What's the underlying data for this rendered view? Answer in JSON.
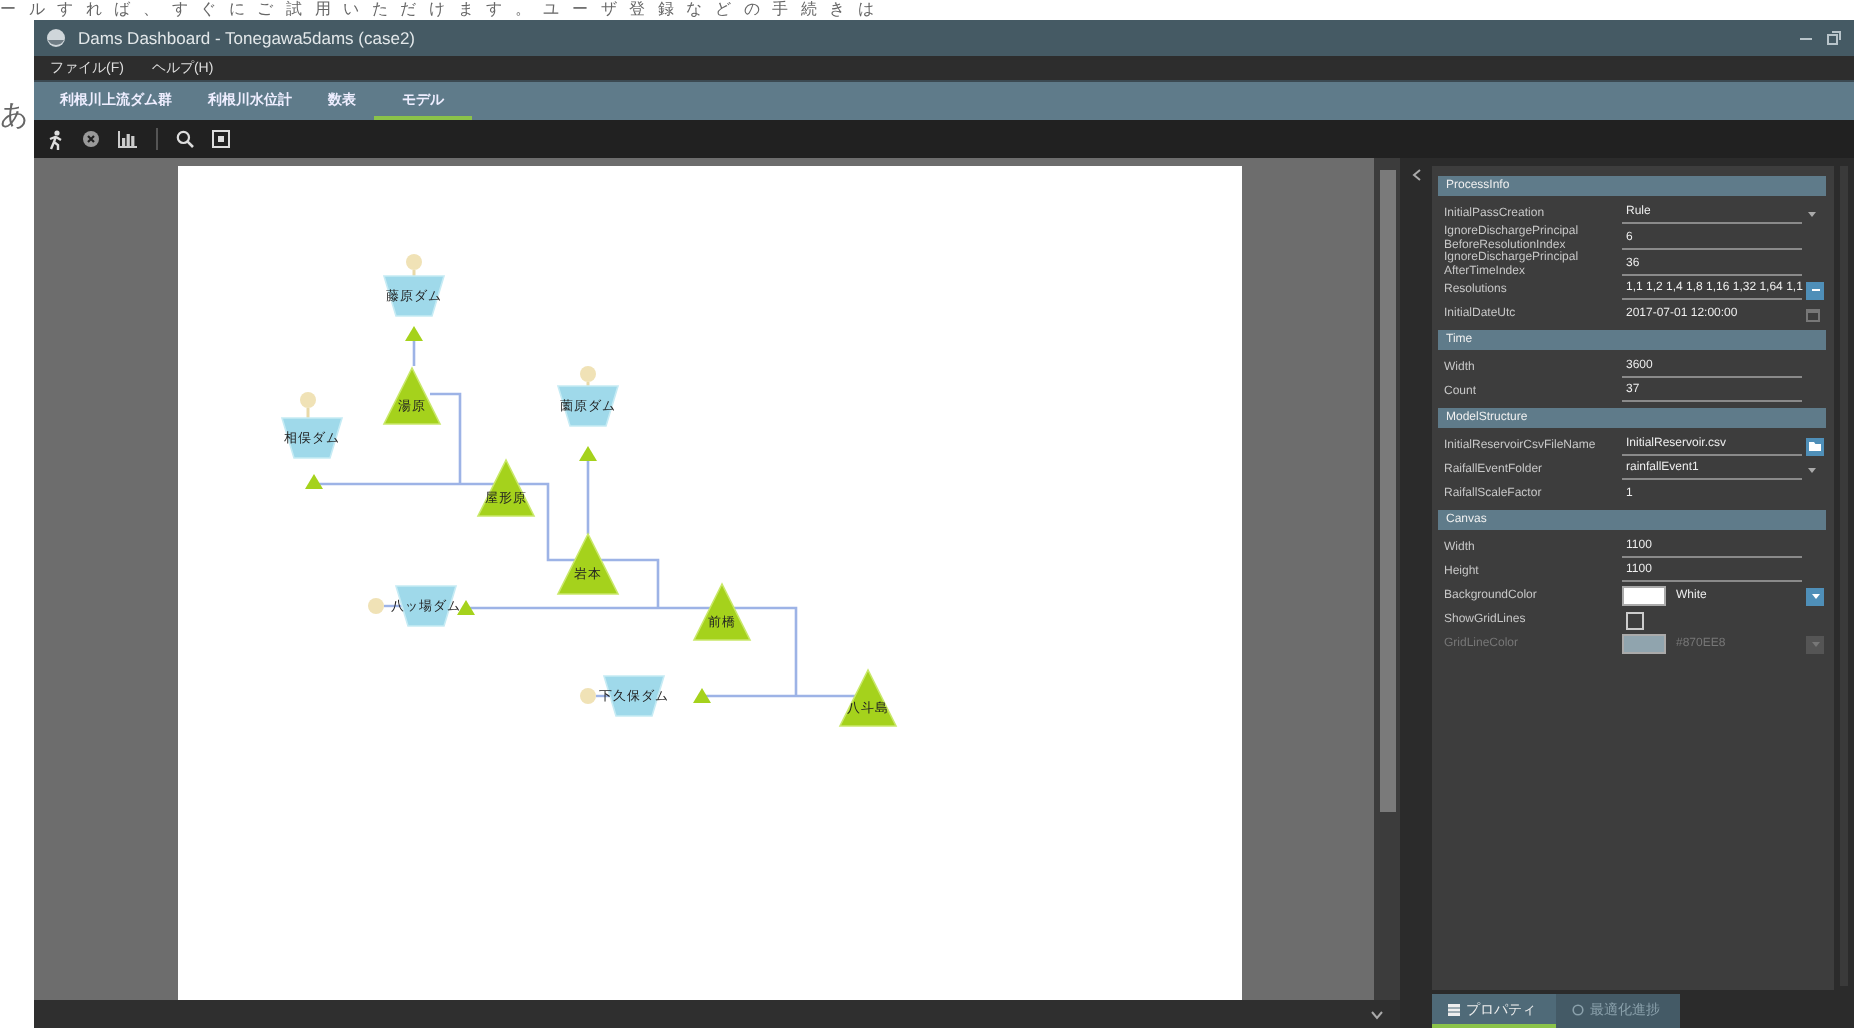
{
  "background_page": {
    "text_line": "ールすれば、すぐにご試用いただけます。ユーザ登録などの手続きは",
    "side_text": "あ"
  },
  "window": {
    "title": "Dams Dashboard - Tonegawa5dams (case2)"
  },
  "menu": [
    "ファイル(F)",
    "ヘルプ(H)"
  ],
  "tabs": [
    {
      "label": "利根川上流ダム群",
      "selected": false
    },
    {
      "label": "利根川水位計",
      "selected": false
    },
    {
      "label": "数表",
      "selected": false
    },
    {
      "label": "モデル",
      "selected": true
    }
  ],
  "model": {
    "nodes": [
      {
        "kind": "dam",
        "label": "藤原ダム"
      },
      {
        "kind": "point",
        "label": "湯原"
      },
      {
        "kind": "dam",
        "label": "相俣ダム"
      },
      {
        "kind": "dam",
        "label": "薗原ダム"
      },
      {
        "kind": "point",
        "label": "屋形原"
      },
      {
        "kind": "point",
        "label": "岩本"
      },
      {
        "kind": "dam",
        "label": "八ッ場ダム"
      },
      {
        "kind": "point",
        "label": "前橋"
      },
      {
        "kind": "dam",
        "label": "下久保ダム"
      },
      {
        "kind": "point",
        "label": "八斗島"
      }
    ]
  },
  "properties": {
    "sections": [
      {
        "title": "ProcessInfo",
        "rows": [
          {
            "kind": "dropdown",
            "name": "InitialPassCreation",
            "value": "Rule",
            "disabled": false
          },
          {
            "kind": "text",
            "name": "IgnoreDischargePrincipal BeforeResolutionIndex",
            "value": "6",
            "disabled": false
          },
          {
            "kind": "text",
            "name": "IgnoreDischargePrincipal AfterTimeIndex",
            "value": "36",
            "disabled": false
          },
          {
            "kind": "ellipsis",
            "name": "Resolutions",
            "value": "1,1 1,2 1,4 1,8 1,16 1,32 1,64 1,1",
            "disabled": false
          },
          {
            "kind": "date",
            "name": "InitialDateUtc",
            "value": "2017-07-01 12:00:00",
            "disabled": false
          }
        ]
      },
      {
        "title": "Time",
        "rows": [
          {
            "kind": "text",
            "name": "Width",
            "value": "3600",
            "disabled": false
          },
          {
            "kind": "text",
            "name": "Count",
            "value": "37",
            "disabled": false
          }
        ]
      },
      {
        "title": "ModelStructure",
        "rows": [
          {
            "kind": "file",
            "name": "InitialReservoirCsvFileName",
            "value": "InitialReservoir.csv",
            "disabled": false
          },
          {
            "kind": "dropdown",
            "name": "RaifallEventFolder",
            "value": "rainfallEvent1",
            "disabled": false
          },
          {
            "kind": "plain",
            "name": "RaifallScaleFactor",
            "value": "1",
            "disabled": false
          }
        ]
      },
      {
        "title": "Canvas",
        "rows": [
          {
            "kind": "text",
            "name": "Width",
            "value": "1100",
            "disabled": false
          },
          {
            "kind": "text",
            "name": "Height",
            "value": "1100",
            "disabled": false
          },
          {
            "kind": "color",
            "name": "BackgroundColor",
            "value": "White",
            "color": "#ffffff",
            "disabled": false
          },
          {
            "kind": "checkbox",
            "name": "ShowGridLines",
            "checked": false,
            "disabled": false
          },
          {
            "kind": "color",
            "name": "GridLineColor",
            "value": "#870EE8",
            "color": "#90a4ae",
            "disabled": true
          }
        ]
      }
    ]
  },
  "panel_tabs": [
    {
      "label": "プロパティ",
      "selected": true
    },
    {
      "label": "最適化進捗",
      "selected": false
    }
  ]
}
